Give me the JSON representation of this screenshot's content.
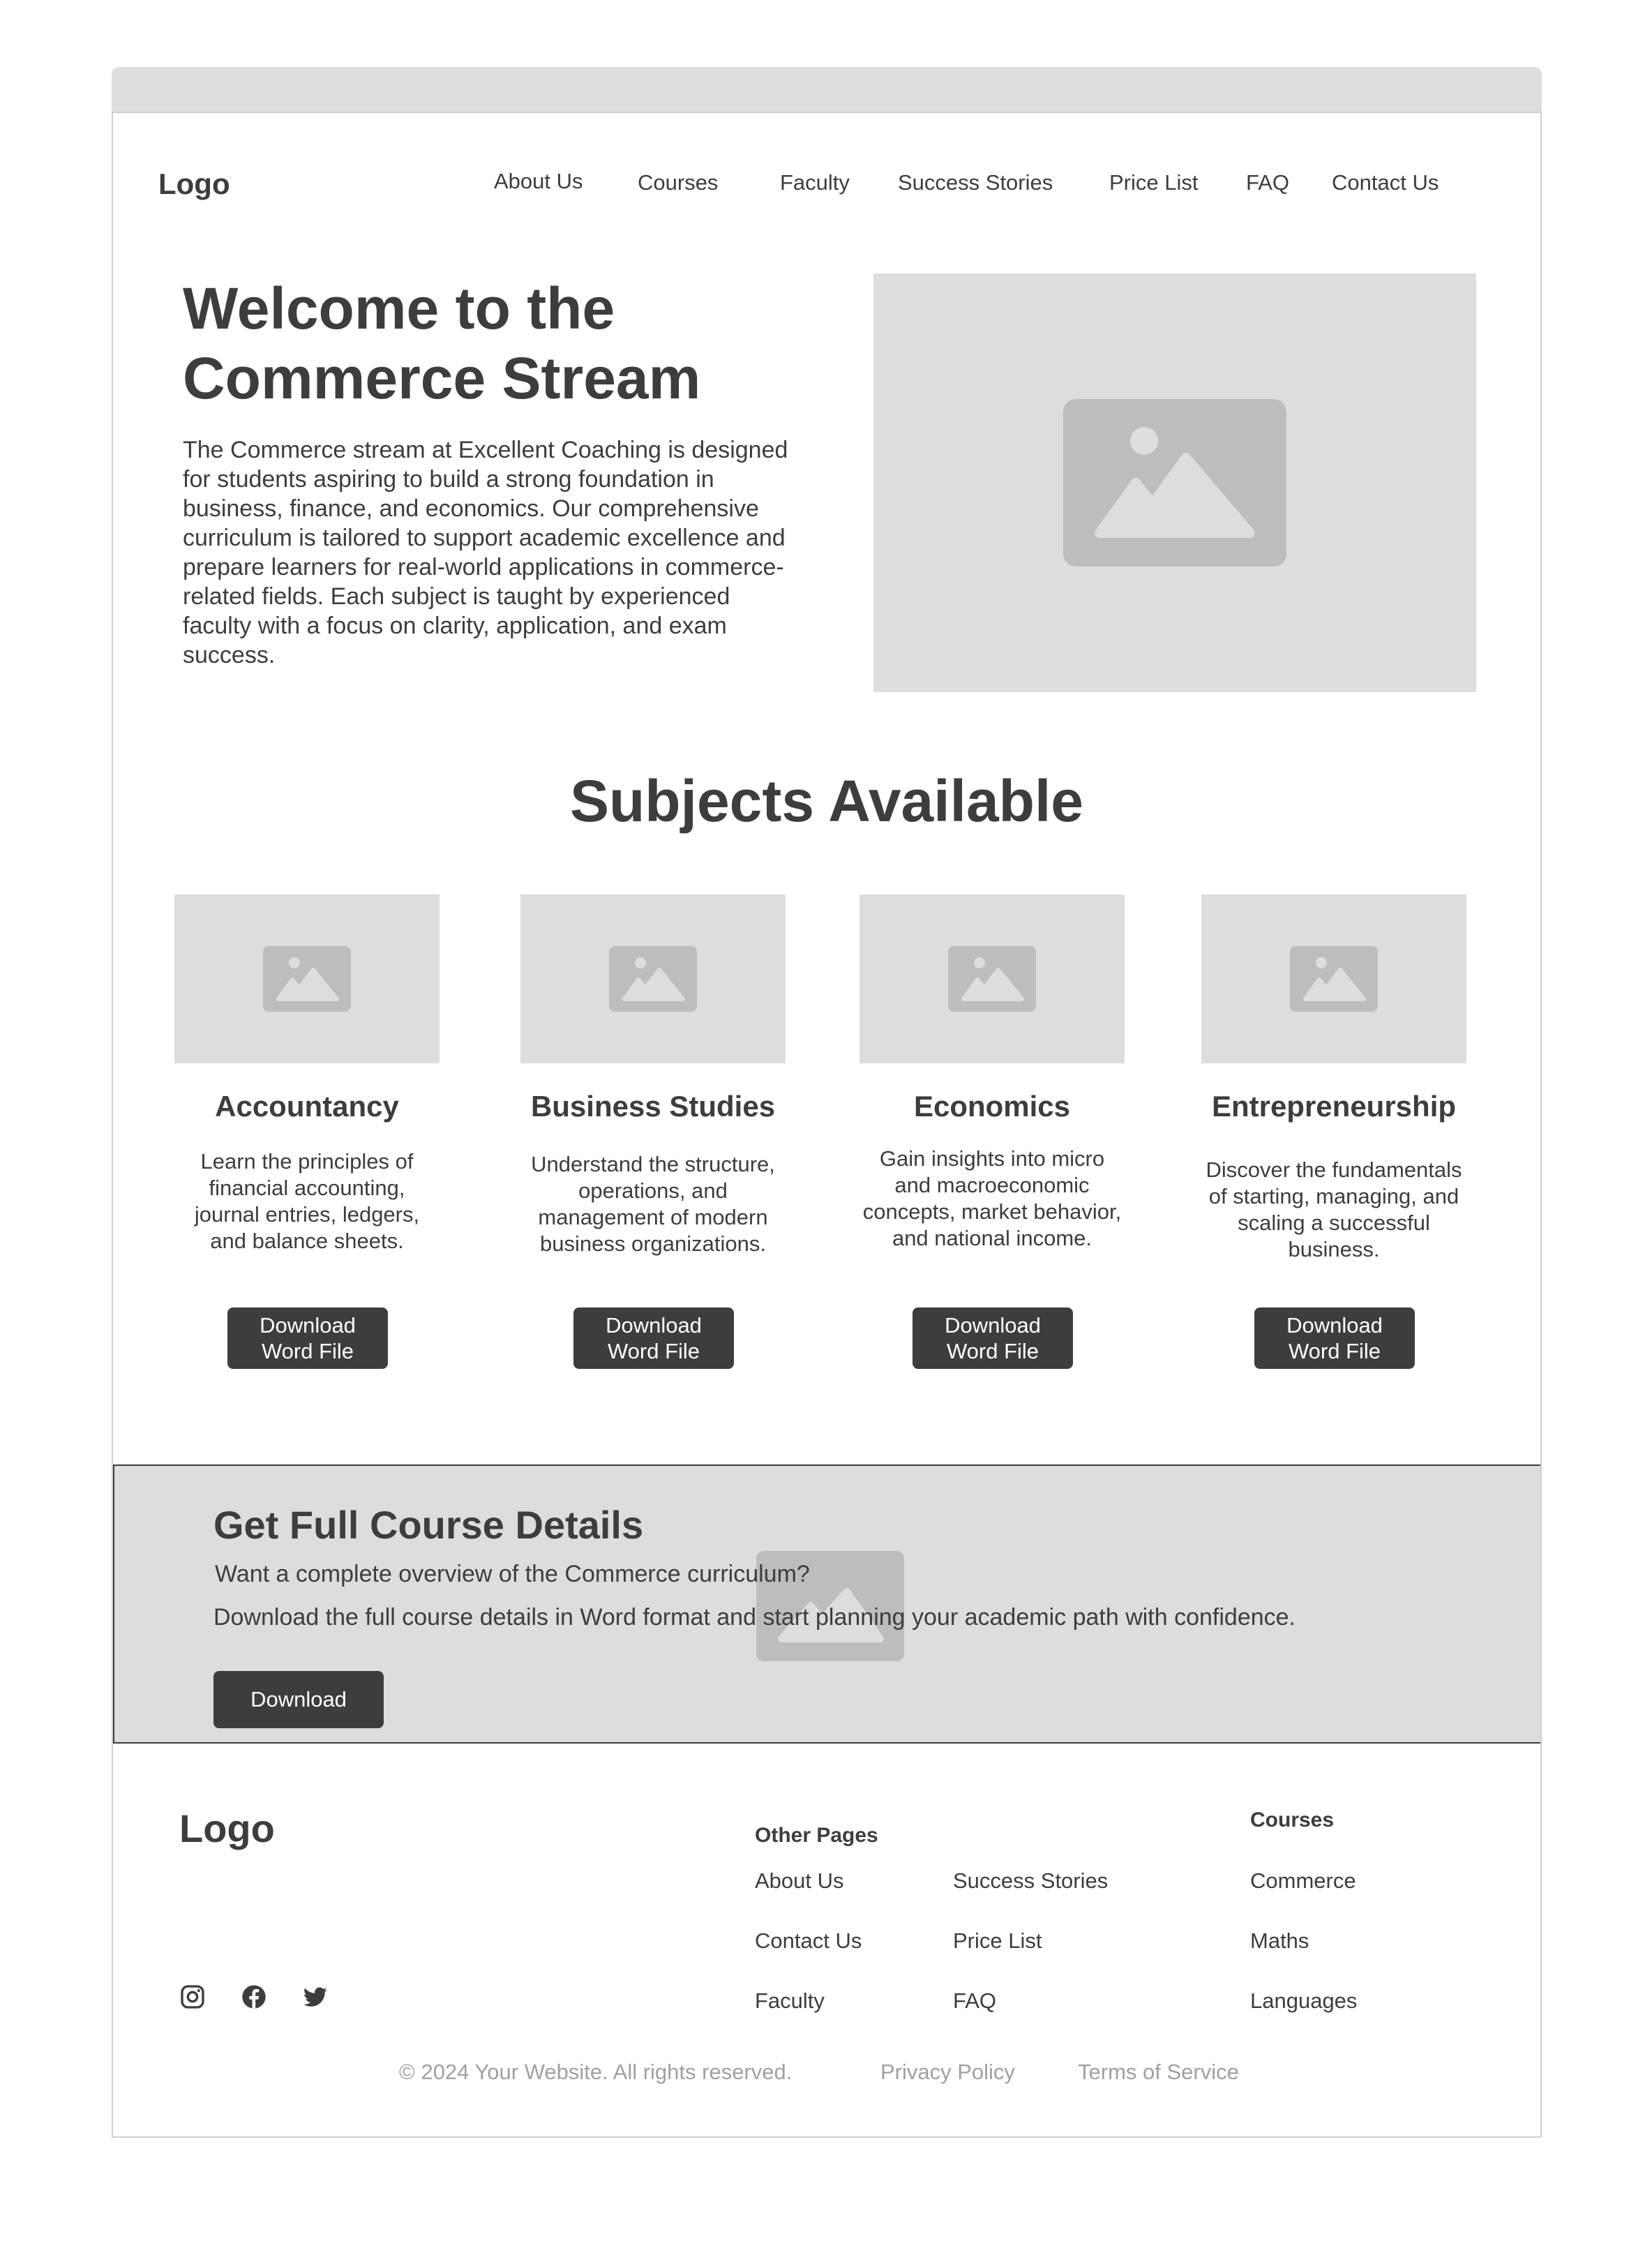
{
  "nav": {
    "logo": "Logo",
    "links": [
      "About Us",
      "Courses",
      "Faculty",
      "Success Stories",
      "Price List",
      "FAQ",
      "Contact Us"
    ]
  },
  "hero": {
    "title": "Welcome to the Commerce Stream",
    "text": "The Commerce stream at Excellent Coaching is designed for students aspiring to build a strong foundation in business, finance, and economics. Our comprehensive curriculum is tailored to support academic excellence and prepare learners for real-world applications in commerce-related fields. Each subject is taught by experienced faculty with a focus on clarity, application, and exam success."
  },
  "subjects": {
    "title": "Subjects Available",
    "cards": [
      {
        "title": "Accountancy",
        "desc": "Learn the principles of financial accounting, journal entries, ledgers, and balance sheets.",
        "button": "Download\nWord File"
      },
      {
        "title": "Business Studies",
        "desc": "Understand the structure, operations, and management of modern business organizations.",
        "button": "Download\nWord File"
      },
      {
        "title": "Economics",
        "desc": "Gain insights into micro and macroeconomic concepts, market behavior, and national income.",
        "button": "Download\nWord File"
      },
      {
        "title": "Entrepreneurship",
        "desc": "Discover the fundamentals of starting, managing, and scaling a successful business.",
        "button": "Download\nWord File"
      }
    ]
  },
  "banner": {
    "title": "Get Full Course Details",
    "text1": "Want a complete overview of the Commerce curriculum?",
    "text2": "Download the full course details in Word format and start planning your academic path with confidence.",
    "button": "Download"
  },
  "footer": {
    "logo": "Logo",
    "other_pages_heading": "Other Pages",
    "other_pages_col1": [
      "About Us",
      "Contact Us",
      "Faculty"
    ],
    "other_pages_col2": [
      "Success Stories",
      "Price List",
      "FAQ"
    ],
    "courses_heading": "Courses",
    "courses": [
      "Commerce",
      "Maths",
      "Languages"
    ],
    "social_icons": [
      "instagram-icon",
      "facebook-icon",
      "twitter-icon"
    ],
    "copyright": "© 2024 Your Website. All rights reserved.",
    "privacy": "Privacy Policy",
    "terms": "Terms of Service"
  },
  "colors": {
    "text": "#3d3d3d",
    "placeholder": "#dddddd",
    "button": "#3d3d3d",
    "muted": "#a0a0a0"
  }
}
